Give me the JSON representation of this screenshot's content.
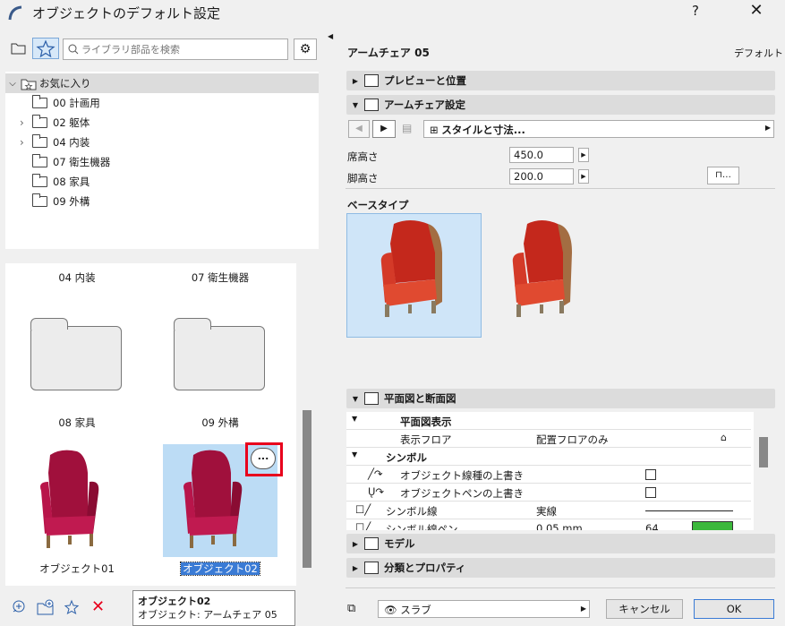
{
  "window": {
    "title": "オブジェクトのデフォルト設定",
    "help": "?",
    "close": "✕"
  },
  "library": {
    "search_placeholder": "ライブラリ部品を検索",
    "tree": [
      {
        "label": "お気に入り",
        "expand": "⌵",
        "selected": true
      },
      {
        "label": "00 計画用",
        "expand": ""
      },
      {
        "label": "02 躯体",
        "expand": "›"
      },
      {
        "label": "04 内装",
        "expand": "›"
      },
      {
        "label": "07 衛生機器",
        "expand": ""
      },
      {
        "label": "08 家具",
        "expand": ""
      },
      {
        "label": "09 外構",
        "expand": ""
      }
    ],
    "grid": [
      {
        "label": "04 内装"
      },
      {
        "label": "07 衛生機器"
      },
      {
        "label": "08 家具"
      },
      {
        "label": "09 外構"
      },
      {
        "label": "オブジェクト01"
      },
      {
        "label": "オブジェクト02"
      }
    ],
    "more_button": "...",
    "tooltip": {
      "name": "オブジェクト02",
      "detail": "オブジェクト: アームチェア 05"
    }
  },
  "settings": {
    "object_name": "アームチェア 05",
    "default_label": "デフォルト",
    "sections": {
      "preview": "プレビューと位置",
      "chair_settings": "アームチェア設定",
      "plan": "平面図と断面図",
      "model": "モデル",
      "classification": "分類とプロパティ"
    },
    "style_dropdown": "スタイルと寸法...",
    "seat_height": {
      "label": "席高さ",
      "value": "450.0"
    },
    "leg_height": {
      "label": "脚高さ",
      "value": "200.0"
    },
    "base_type_label": "ベースタイプ",
    "plan_rows": {
      "plan_display": "平面図表示",
      "floor_label": "表示フロア",
      "floor_value": "配置フロアのみ",
      "symbol": "シンボル",
      "override_linetype": "オブジェクト線種の上書き",
      "override_pen": "オブジェクトペンの上書き",
      "symbol_line": "シンボル線",
      "symbol_line_value": "実線",
      "symbol_pen": "シンボル線ペン",
      "symbol_pen_value": "0.05 mm",
      "symbol_pen_num": "64"
    },
    "layer": "スラブ",
    "cancel": "キャンセル",
    "ok": "OK"
  },
  "colors": {
    "accent": "#3a7bd5",
    "selected_bg": "#bcdcf5",
    "highlight_red": "#e8001c",
    "pen_green": "#3cb83c"
  }
}
